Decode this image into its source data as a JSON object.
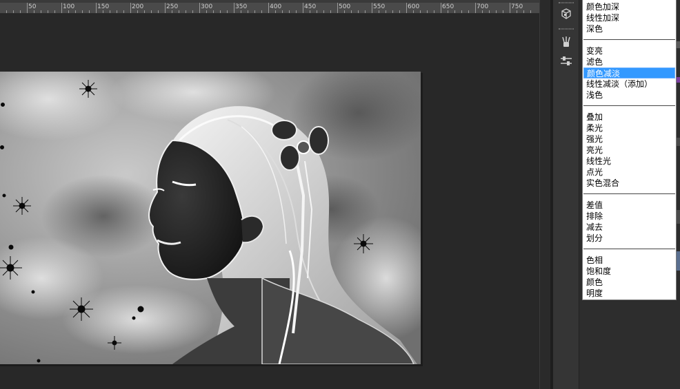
{
  "ruler": {
    "labels": [
      "50",
      "100",
      "150",
      "200",
      "250",
      "300",
      "350",
      "400",
      "450",
      "500",
      "550",
      "600",
      "650",
      "700",
      "750"
    ]
  },
  "canvas": {
    "image_description_icon": "inverted-glowing-edges-portrait"
  },
  "toolstrip": {
    "tools": [
      "3d-cube-icon",
      "brush-presets-icon",
      "adjust-sliders-icon"
    ]
  },
  "blend_menu": {
    "groups": [
      [
        "颜色加深",
        "线性加深",
        "深色"
      ],
      [
        "变亮",
        "滤色",
        "颜色减淡",
        "线性减淡（添加）",
        "浅色"
      ],
      [
        "叠加",
        "柔光",
        "强光",
        "亮光",
        "线性光",
        "点光",
        "实色混合"
      ],
      [
        "差值",
        "排除",
        "减去",
        "划分"
      ],
      [
        "色相",
        "饱和度",
        "颜色",
        "明度"
      ]
    ],
    "selected": "颜色减淡"
  },
  "colors": {
    "workspace": "#282828",
    "ruler": "#4a4a4a",
    "menu_highlight": "#3399ff",
    "panel": "#2d2d2d"
  }
}
